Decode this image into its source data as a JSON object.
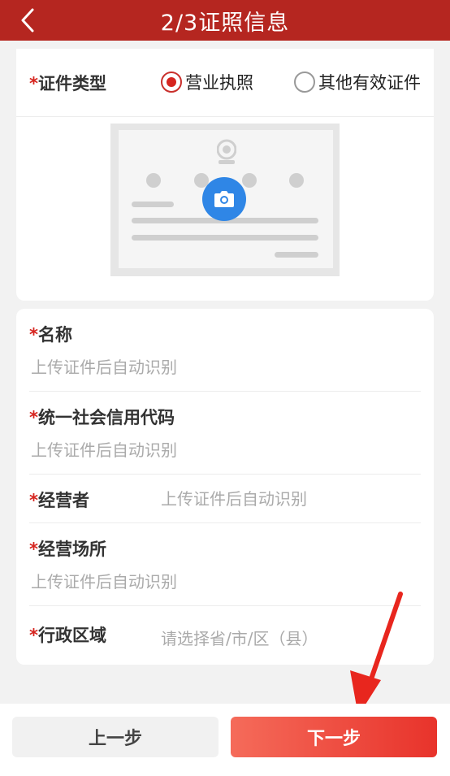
{
  "header": {
    "title": "2/3证照信息",
    "back_icon": "chevron-left-icon",
    "bg_color": "#b52620"
  },
  "cert_type": {
    "required_mark": "*",
    "label": "证件类型",
    "options": [
      {
        "label": "营业执照",
        "selected": true
      },
      {
        "label": "其他有效证件",
        "selected": false
      }
    ]
  },
  "upload": {
    "icon": "camera-icon",
    "emblem_icon": "national-emblem-icon"
  },
  "fields": [
    {
      "required_mark": "*",
      "label": "名称",
      "placeholder": "上传证件后自动识别"
    },
    {
      "required_mark": "*",
      "label": "统一社会信用代码",
      "placeholder": "上传证件后自动识别"
    },
    {
      "required_mark": "*",
      "label": "经营者",
      "placeholder": "上传证件后自动识别"
    },
    {
      "required_mark": "*",
      "label": "经营场所",
      "placeholder": "上传证件后自动识别"
    },
    {
      "required_mark": "*",
      "label": "行政区域",
      "placeholder": "请选择省/市/区（县）"
    }
  ],
  "footer": {
    "prev_label": "上一步",
    "next_label": "下一步",
    "accent_color": "#e8332b"
  }
}
